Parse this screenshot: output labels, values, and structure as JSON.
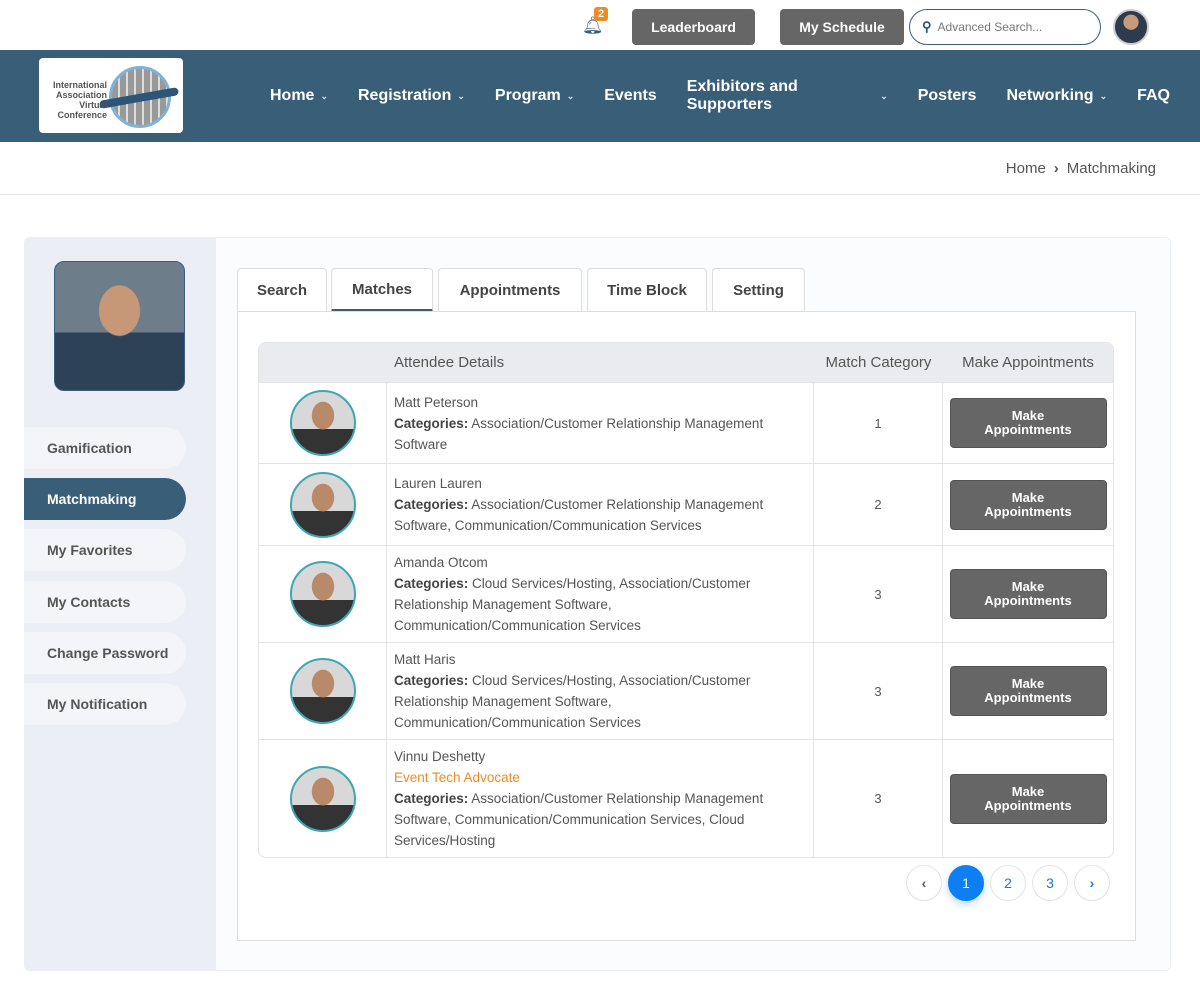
{
  "topbar": {
    "notification_count": "2",
    "leaderboard": "Leaderboard",
    "my_schedule": "My Schedule",
    "search_placeholder": "Advanced Search..."
  },
  "logo": {
    "text": "International Association Virtual Conference"
  },
  "nav": [
    {
      "label": "Home",
      "dropdown": true
    },
    {
      "label": "Registration",
      "dropdown": true
    },
    {
      "label": "Program",
      "dropdown": true
    },
    {
      "label": "Events",
      "dropdown": false
    },
    {
      "label": "Exhibitors and Supporters",
      "dropdown": true
    },
    {
      "label": "Posters",
      "dropdown": false
    },
    {
      "label": "Networking",
      "dropdown": true
    },
    {
      "label": "FAQ",
      "dropdown": false
    }
  ],
  "breadcrumb": {
    "home": "Home",
    "sep": "›",
    "current": "Matchmaking"
  },
  "sidebar": {
    "items": [
      "Gamification",
      "Matchmaking",
      "My Favorites",
      "My Contacts",
      "Change Password",
      "My Notification"
    ],
    "active": "Matchmaking"
  },
  "tabs": [
    "Search",
    "Matches",
    "Appointments",
    "Time Block",
    "Setting"
  ],
  "active_tab": "Matches",
  "table": {
    "headers": [
      "",
      "Attendee Details",
      "Match Category",
      "Make Appointments"
    ],
    "categories_label": "Categories:",
    "button_label": "Make Appointments",
    "rows": [
      {
        "name": "Matt Peterson",
        "badge": "",
        "categories": "Association/Customer Relationship Management Software",
        "match": "1"
      },
      {
        "name": "Lauren Lauren",
        "badge": "",
        "categories": "Association/Customer Relationship Management Software, Communication/Communication Services",
        "match": "2"
      },
      {
        "name": "Amanda Otcom",
        "badge": "",
        "categories": "Cloud Services/Hosting, Association/Customer Relationship Management Software, Communication/Communication Services",
        "match": "3"
      },
      {
        "name": "Matt Haris",
        "badge": "",
        "categories": "Cloud Services/Hosting, Association/Customer Relationship Management Software, Communication/Communication Services",
        "match": "3"
      },
      {
        "name": "Vinnu Deshetty",
        "badge": "Event Tech Advocate",
        "categories": "Association/Customer Relationship Management Software, Communication/Communication Services, Cloud Services/Hosting",
        "match": "3"
      }
    ]
  },
  "pagination": {
    "prev": "‹",
    "pages": [
      "1",
      "2",
      "3"
    ],
    "current": "1",
    "next": "›"
  }
}
